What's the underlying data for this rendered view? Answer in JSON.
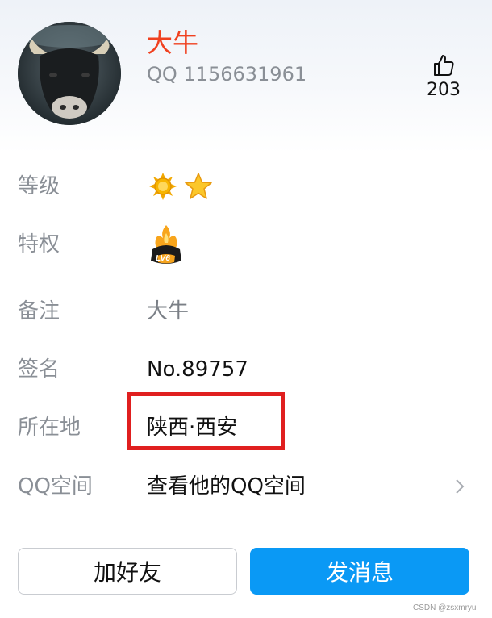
{
  "profile": {
    "nickname": "大牛",
    "qq_number": "QQ 1156631961",
    "likes": "203",
    "like_icon": "thumbs-up-icon",
    "avatar": "bull-photo"
  },
  "rows": {
    "level": {
      "label": "等级",
      "icons": [
        "sun-icon",
        "star-icon"
      ]
    },
    "privilege": {
      "label": "特权",
      "badge_text": "LV6",
      "icon": "svip-crown-icon"
    },
    "remark": {
      "label": "备注",
      "value": "大牛"
    },
    "signature": {
      "label": "签名",
      "value": "No.89757"
    },
    "location": {
      "label": "所在地",
      "value": "陕西·西安"
    },
    "qzone": {
      "label": "QQ空间",
      "value": "查看他的QQ空间",
      "icon": "chevron-right-icon"
    }
  },
  "buttons": {
    "add_friend": "加好友",
    "send_message": "发消息"
  },
  "watermark": "CSDN @zsxmryu",
  "colors": {
    "nickname": "#f0401f",
    "primary": "#0a99f5",
    "highlight": "#e01f1f"
  }
}
